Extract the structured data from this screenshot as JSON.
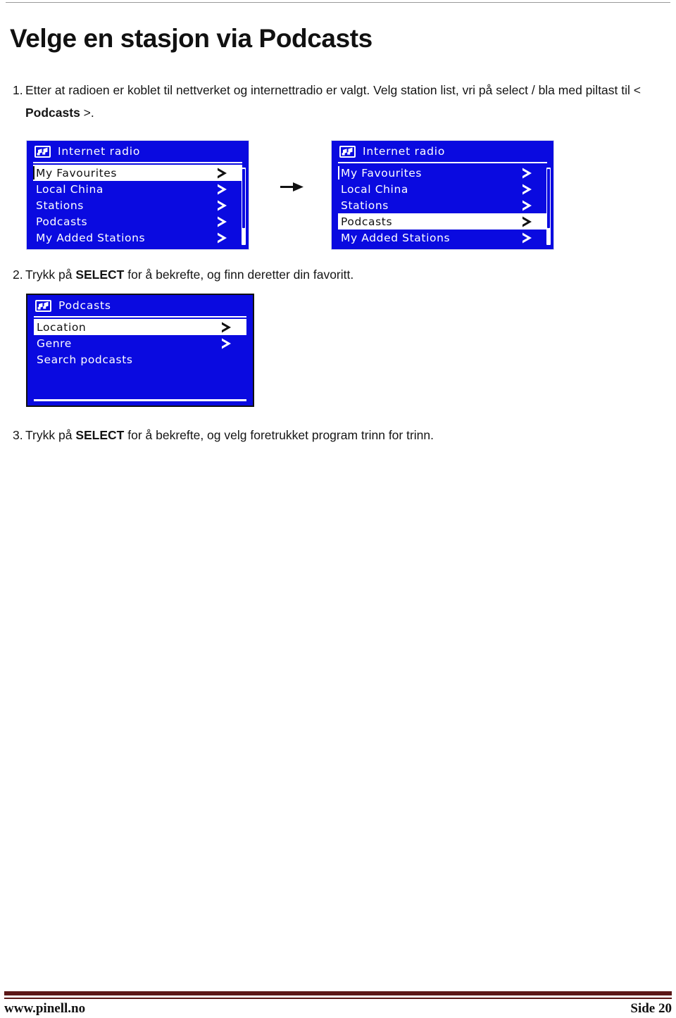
{
  "document": {
    "title": "Velge en stasjon via Podcasts"
  },
  "steps": [
    {
      "number": "1.",
      "text_part_1": "Etter at radioen er koblet til nettverket og internettradio er valgt. Velg station list, vri på select / bla med piltast til < ",
      "bold": "Podcasts",
      "text_part_2": " >."
    },
    {
      "number": "2.",
      "text_part_1": "Trykk på ",
      "bold": "SELECT",
      "text_part_2": " for å bekrefte, og finn deretter din favoritt."
    },
    {
      "number": "3.",
      "text_part_1": "Trykk på ",
      "bold": "SELECT",
      "text_part_2": " for å bekrefte, og velg foretrukket program trinn for trinn."
    }
  ],
  "displays": [
    {
      "id": "display-1",
      "header_title": "Internet radio",
      "header_icon": "music-note-icon",
      "rows": [
        {
          "label": "My Favourites",
          "chevron": true,
          "selected": true
        },
        {
          "label": "Local China",
          "chevron": true,
          "selected": false
        },
        {
          "label": "Stations",
          "chevron": true,
          "selected": false
        },
        {
          "label": "Podcasts",
          "chevron": true,
          "selected": false
        },
        {
          "label": "My Added Stations",
          "chevron": true,
          "selected": false
        }
      ]
    },
    {
      "id": "display-2",
      "header_title": "Internet radio",
      "header_icon": "music-note-icon",
      "rows": [
        {
          "label": "My Favourites",
          "chevron": true,
          "selected": false
        },
        {
          "label": "Local China",
          "chevron": true,
          "selected": false
        },
        {
          "label": "Stations",
          "chevron": true,
          "selected": false
        },
        {
          "label": "Podcasts",
          "chevron": true,
          "selected": true
        },
        {
          "label": "My Added Stations",
          "chevron": true,
          "selected": false
        }
      ]
    },
    {
      "id": "display-3",
      "header_title": "Podcasts",
      "header_icon": "music-note-icon",
      "rows": [
        {
          "label": "Location",
          "chevron": true,
          "selected": true
        },
        {
          "label": "Genre",
          "chevron": true,
          "selected": false
        },
        {
          "label": "Search podcasts",
          "chevron": false,
          "selected": false
        }
      ]
    }
  ],
  "flow": {
    "arrow": "right-arrow-icon"
  },
  "footer": {
    "left": "www.pinell.no",
    "right": "Side 20"
  },
  "colors": {
    "lcd_background": "#0a0ae0",
    "lcd_foreground": "#ffffff",
    "footer_rule": "#5b1717",
    "title_text": "#111111"
  }
}
